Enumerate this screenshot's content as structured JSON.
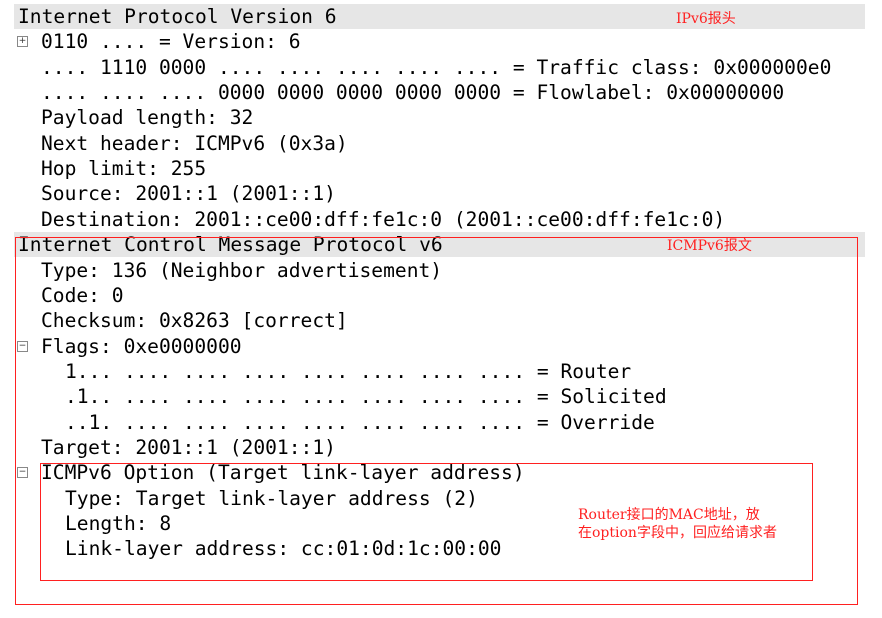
{
  "tree": [
    {
      "text": "Internet Protocol Version 6",
      "level": 0,
      "header": true
    },
    {
      "text": "0110 .... = Version: 6",
      "level": 1,
      "toggle": "expand"
    },
    {
      "text": ".... 1110 0000 .... .... .... .... .... = Traffic class: 0x000000e0",
      "level": 1
    },
    {
      "text": ".... .... .... 0000 0000 0000 0000 0000 = Flowlabel: 0x00000000",
      "level": 1
    },
    {
      "text": "Payload length: 32",
      "level": 1
    },
    {
      "text": "Next header: ICMPv6 (0x3a)",
      "level": 1
    },
    {
      "text": "Hop limit: 255",
      "level": 1
    },
    {
      "text": "Source: 2001::1 (2001::1)",
      "level": 1
    },
    {
      "text": "Destination: 2001::ce00:dff:fe1c:0 (2001::ce00:dff:fe1c:0)",
      "level": 1
    },
    {
      "text": "Internet Control Message Protocol v6",
      "level": 0,
      "header": true
    },
    {
      "text": "Type: 136 (Neighbor advertisement)",
      "level": 1
    },
    {
      "text": "Code: 0",
      "level": 1
    },
    {
      "text": "Checksum: 0x8263 [correct]",
      "level": 1
    },
    {
      "text": "Flags: 0xe0000000",
      "level": 1,
      "toggle": "collapse"
    },
    {
      "text": "1... .... .... .... .... .... .... .... = Router",
      "level": 2
    },
    {
      "text": ".1.. .... .... .... .... .... .... .... = Solicited",
      "level": 2
    },
    {
      "text": "..1. .... .... .... .... .... .... .... = Override",
      "level": 2
    },
    {
      "text": "Target: 2001::1 (2001::1)",
      "level": 1
    },
    {
      "text": "ICMPv6 Option (Target link-layer address)",
      "level": 1,
      "toggle": "collapse"
    },
    {
      "text": "Type: Target link-layer address (2)",
      "level": 2
    },
    {
      "text": "Length: 8",
      "level": 2
    },
    {
      "text": "Link-layer address: cc:01:0d:1c:00:00",
      "level": 2
    }
  ],
  "annotations": {
    "ipv6_header": "IPv6报头",
    "icmpv6_message": "ICMPv6报文",
    "option_note": "Router接口的MAC地址，放\n在option字段中，回应给请求者"
  },
  "colors": {
    "annotation": "#ff2020",
    "header_bg": "#e6e6e6"
  }
}
